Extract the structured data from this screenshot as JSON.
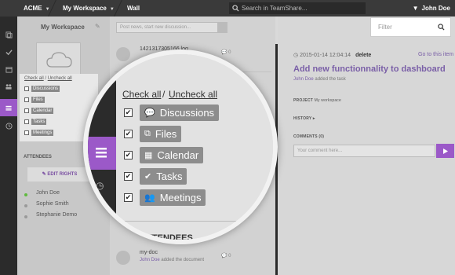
{
  "topbar": {
    "org": "ACME",
    "workspace": "My Workspace",
    "page": "Wall",
    "search_placeholder": "Search in TeamShare...",
    "user": "John Doe"
  },
  "sidebar": {
    "title": "My Workspace",
    "check_all": "Check all",
    "uncheck_all": "Uncheck all",
    "filters": [
      {
        "label": "Discussions",
        "icon": "chat-icon",
        "checked": true
      },
      {
        "label": "Files",
        "icon": "files-icon",
        "checked": true
      },
      {
        "label": "Calendar",
        "icon": "calendar-icon",
        "checked": true
      },
      {
        "label": "Tasks",
        "icon": "check-icon",
        "checked": true
      },
      {
        "label": "Meetings",
        "icon": "people-icon",
        "checked": true
      }
    ],
    "attendees_label": "ATTENDEES",
    "edit_rights": "EDIT RIGHTS",
    "attendees": [
      {
        "name": "John Doe",
        "status": "#5fba3e"
      },
      {
        "name": "Sophie Smith",
        "status": "#9a9a9a"
      },
      {
        "name": "Stephanie Demo",
        "status": "#9a9a9a"
      }
    ]
  },
  "feed": {
    "post_placeholder": "Post news, start new discussion...",
    "items": [
      {
        "title": "1421317305166.log",
        "sub_user": "",
        "sub_text": "",
        "count": "0"
      },
      {
        "title": "my-doc",
        "sub_user": "John Doe",
        "sub_text": "added the document",
        "count": "0"
      }
    ]
  },
  "detail": {
    "filter_placeholder": "Filter",
    "date": "2015-01-14 12:04:14",
    "action": "delete",
    "goto": "Go to this item",
    "title": "Add new functionnality to dashboard",
    "sub_user": "John Doe",
    "sub_text": "added the task",
    "project_label": "PROJECT",
    "project_value": "My workspace",
    "history_label": "HISTORY",
    "comments_label": "COMMENTS (0)",
    "comment_placeholder": "Your comment here..."
  },
  "magnifier": {
    "check_all": "Check all",
    "separator": "/",
    "uncheck_all": "Uncheck all",
    "filters": [
      "Discussions",
      "Files",
      "Calendar",
      "Tasks",
      "Meetings"
    ],
    "attendees_label": "ATTENDEES"
  },
  "colors": {
    "accent": "#9b59c8",
    "link": "#7a5fa7",
    "topbar": "#3a3a3a"
  }
}
